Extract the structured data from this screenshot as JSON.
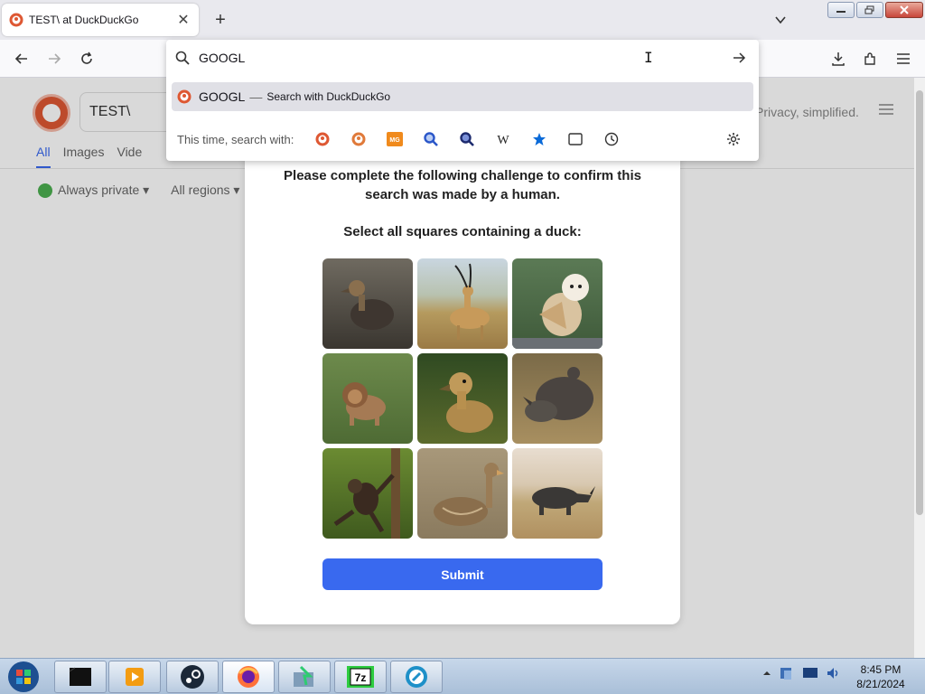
{
  "browser": {
    "tab_title": "TEST\\ at DuckDuckGo",
    "close_tab_symbol": "✕",
    "new_tab_symbol": "+"
  },
  "urlbar": {
    "value": "GOOGL",
    "suggestion": {
      "term": "GOOGL",
      "separator": "—",
      "action": "Search with DuckDuckGo"
    },
    "oneoff_label": "This time, search with:",
    "engines": [
      "duckduckgo-icon",
      "duckduckgo-alt-icon",
      "mg-icon",
      "search-engine-blue-icon",
      "search-engine-dark-icon",
      "wikipedia-icon",
      "bookmarks-icon",
      "tabs-icon",
      "history-icon"
    ],
    "wikipedia_letter": "W",
    "mg_letters": "MG"
  },
  "page": {
    "search_value": "TEST\\",
    "tabs": [
      "All",
      "Images",
      "Vide"
    ],
    "filter_private": "Always private ▾",
    "filter_region": "All regions ▾",
    "tagline": "Privacy, simplified."
  },
  "challenge": {
    "instructions": "Please complete the following challenge to confirm this search was made by a human.",
    "prompt": "Select all squares containing a duck:",
    "tiles": [
      "duck",
      "gazelle",
      "owl",
      "lion",
      "duck",
      "rhino",
      "monkey",
      "duck",
      "rhino"
    ],
    "submit_label": "Submit"
  },
  "taskbar": {
    "time": "8:45 PM",
    "date": "8/21/2024",
    "seven_zip_label": "7z"
  },
  "colors": {
    "accent": "#3969ef",
    "ddg_orange": "#de5833"
  }
}
